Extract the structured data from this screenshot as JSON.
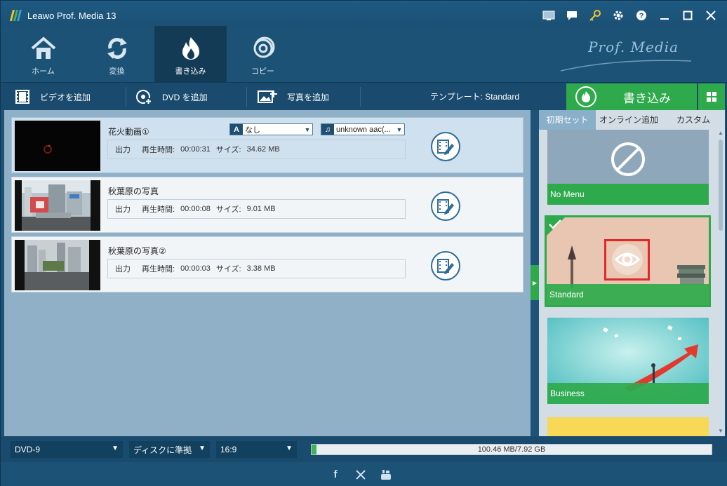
{
  "app": {
    "title": "Leawo Prof. Media 13",
    "brand": "Prof. Media"
  },
  "nav": {
    "tabs": [
      {
        "label": "ホーム",
        "icon": "home-icon"
      },
      {
        "label": "変換",
        "icon": "convert-icon"
      },
      {
        "label": "書き込み",
        "icon": "burn-fire-icon",
        "active": true
      },
      {
        "label": "コピー",
        "icon": "copy-disc-icon"
      }
    ]
  },
  "actions": {
    "add_video": "ビデオを追加",
    "add_dvd": "DVD を追加",
    "add_photo": "写真を追加",
    "template": "テンプレート: Standard",
    "burn": "書き込み"
  },
  "items": [
    {
      "title": "花火動画①",
      "output": "出力",
      "duration_label": "再生時間:",
      "duration": "00:00:31",
      "size_label": "サイズ:",
      "size": "34.62 MB",
      "subtitle": "なし",
      "audio": "unknown aac(...",
      "selected": true
    },
    {
      "title": "秋葉原の写真",
      "output": "出力",
      "duration_label": "再生時間:",
      "duration": "00:00:08",
      "size_label": "サイズ:",
      "size": "9.01 MB"
    },
    {
      "title": "秋葉原の写真②",
      "output": "出力",
      "duration_label": "再生時間:",
      "duration": "00:00:03",
      "size_label": "サイズ:",
      "size": "3.38 MB"
    }
  ],
  "right_panel": {
    "tabs": [
      "初期セット",
      "オンライン追加",
      "カスタム"
    ],
    "templates": [
      {
        "label": "No Menu"
      },
      {
        "label": "Standard",
        "selected": true
      },
      {
        "label": "Business"
      }
    ]
  },
  "bottom": {
    "disc_type": "DVD-9",
    "quality": "ディスクに準拠",
    "aspect": "16:9",
    "capacity_text": "100.46 MB/7.92 GB",
    "capacity_fraction": 0.0124
  },
  "colors": {
    "accent_green": "#2eaa4c",
    "nav_blue": "#1c5276"
  }
}
